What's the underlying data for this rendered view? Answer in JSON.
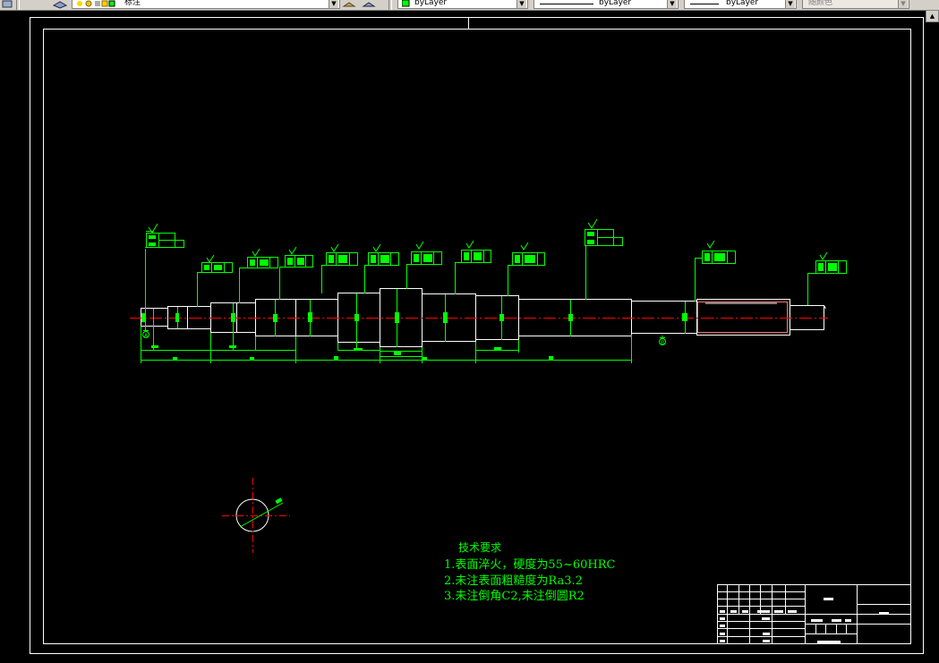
{
  "toolbar": {
    "layer_name": "标注",
    "color_value": "byLayer",
    "linetype_value": "byLayer",
    "lineweight_value": "byLayer",
    "plotstyle_value": "随颜色"
  },
  "drawing": {
    "tech_title": "技术要求",
    "tech_items": [
      "1.表面淬火，硬度为55~60HRC",
      "2.未注表面粗糙度为Ra3.2",
      "3.未注倒角C2,未注倒圆R2"
    ],
    "datum_a": "A",
    "datum_b": "B",
    "colors": {
      "background": "#000000",
      "outline": "#ffffff",
      "dimension": "#00ff00",
      "centerline": "#ff0000"
    }
  }
}
